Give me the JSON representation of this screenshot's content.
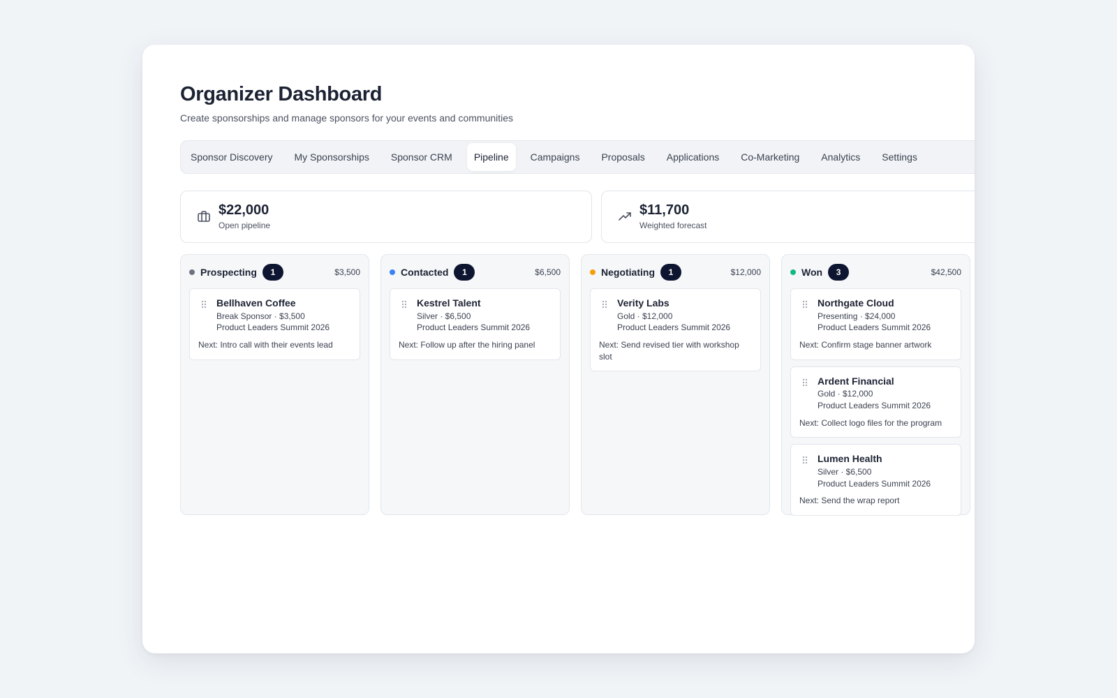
{
  "header": {
    "title": "Organizer Dashboard",
    "subtitle": "Create sponsorships and manage sponsors for your events and communities"
  },
  "tabs": [
    {
      "label": "Sponsor Discovery",
      "active": false
    },
    {
      "label": "My Sponsorships",
      "active": false
    },
    {
      "label": "Sponsor CRM",
      "active": false
    },
    {
      "label": "Pipeline",
      "active": true
    },
    {
      "label": "Campaigns",
      "active": false
    },
    {
      "label": "Proposals",
      "active": false
    },
    {
      "label": "Applications",
      "active": false
    },
    {
      "label": "Co-Marketing",
      "active": false
    },
    {
      "label": "Analytics",
      "active": false
    },
    {
      "label": "Settings",
      "active": false
    }
  ],
  "stats": [
    {
      "value": "$22,000",
      "label": "Open pipeline",
      "icon": "briefcase-icon"
    },
    {
      "value": "$11,700",
      "label": "Weighted forecast",
      "icon": "trending-up-icon"
    }
  ],
  "columns": [
    {
      "title": "Prospecting",
      "count": "1",
      "total": "$3,500",
      "color": "#6b7280",
      "cards": [
        {
          "name": "Bellhaven Coffee",
          "tier": "Break Sponsor · $3,500",
          "event": "Product Leaders Summit 2026",
          "next": "Next: Intro call with their events lead"
        }
      ]
    },
    {
      "title": "Contacted",
      "count": "1",
      "total": "$6,500",
      "color": "#3b82f6",
      "cards": [
        {
          "name": "Kestrel Talent",
          "tier": "Silver · $6,500",
          "event": "Product Leaders Summit 2026",
          "next": "Next: Follow up after the hiring panel"
        }
      ]
    },
    {
      "title": "Negotiating",
      "count": "1",
      "total": "$12,000",
      "color": "#f59e0b",
      "cards": [
        {
          "name": "Verity Labs",
          "tier": "Gold · $12,000",
          "event": "Product Leaders Summit 2026",
          "next": "Next: Send revised tier with workshop slot"
        }
      ]
    },
    {
      "title": "Won",
      "count": "3",
      "total": "$42,500",
      "color": "#10b981",
      "cards": [
        {
          "name": "Northgate Cloud",
          "tier": "Presenting · $24,000",
          "event": "Product Leaders Summit 2026",
          "next": "Next: Confirm stage banner artwork"
        },
        {
          "name": "Ardent Financial",
          "tier": "Gold · $12,000",
          "event": "Product Leaders Summit 2026",
          "next": "Next: Collect logo files for the program"
        },
        {
          "name": "Lumen Health",
          "tier": "Silver · $6,500",
          "event": "Product Leaders Summit 2026",
          "next": "Next: Send the wrap report"
        }
      ]
    }
  ]
}
